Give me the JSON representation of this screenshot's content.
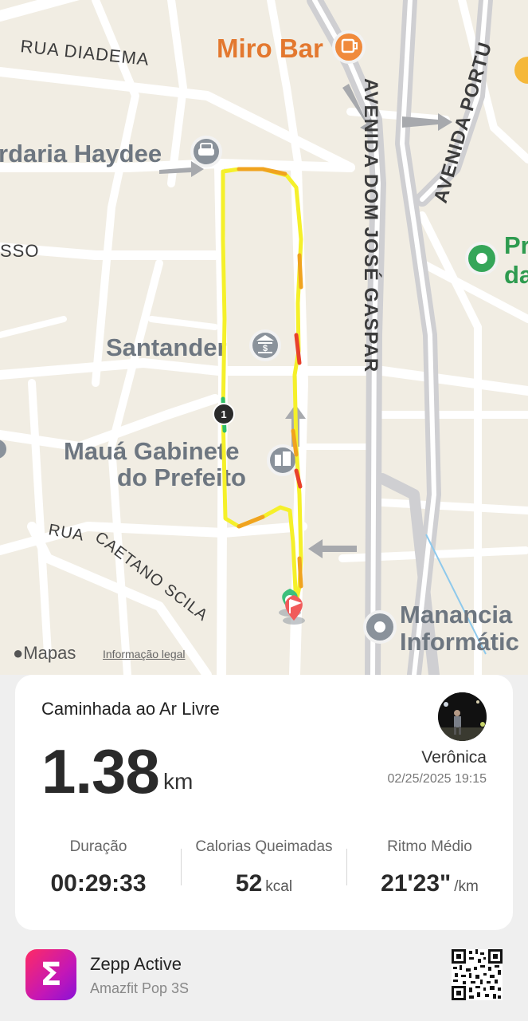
{
  "map": {
    "pois": [
      {
        "id": "miro-bar",
        "label": "Miro Bar",
        "icon": "cocktail-icon",
        "color": "#e3782f"
      },
      {
        "id": "haydee",
        "label": "rdaria Haydee",
        "icon": "car-icon",
        "color": "#7d8792"
      },
      {
        "id": "santander",
        "label": "Santander",
        "icon": "bank-icon",
        "color": "#7d8792"
      },
      {
        "id": "maua-1",
        "label": "Mauá Gabinete",
        "icon": "building-icon",
        "color": "#7d8792"
      },
      {
        "id": "maua-2",
        "label": "do Prefeito",
        "color": "#7d8792"
      },
      {
        "id": "pr-1",
        "label": "Pr",
        "icon": "park-icon",
        "color": "#2e9b4f"
      },
      {
        "id": "pr-2",
        "label": "da",
        "color": "#2e9b4f"
      },
      {
        "id": "manancia-1",
        "label": "Manancia",
        "icon": "pin-icon",
        "color": "#7d8792"
      },
      {
        "id": "manancia-2",
        "label": "Informátic",
        "color": "#7d8792"
      }
    ],
    "streets": [
      "RUA DIADEMA",
      "SSO",
      "RUA CAETANO SCILA",
      "AVENIDA DOM JOSÉ GASPAR",
      "AVENIDA PORTU"
    ],
    "km_marker": "1",
    "route_colors": {
      "fast": "#f5f02a",
      "slow": "#f0a31f",
      "slowest": "#e8412b",
      "start": "#2fbf6a"
    },
    "brand": "Mapas",
    "legal": "Informação legal"
  },
  "activity": {
    "type": "Caminhada ao Ar Livre",
    "distance": "1.38",
    "distance_unit": "km",
    "user_name": "Verônica",
    "timestamp": "02/25/2025 19:15"
  },
  "stats": [
    {
      "label": "Duração",
      "value": "00:29:33",
      "unit": ""
    },
    {
      "label": "Calorias Queimadas",
      "value": "52",
      "unit": "kcal"
    },
    {
      "label": "Ritmo Médio",
      "value": "21'23\"",
      "unit": "/km"
    }
  ],
  "footer": {
    "app_name": "Zepp Active",
    "device_name": "Amazfit Pop 3S",
    "logo_glyph": "Σ",
    "qr_icon": "qr-code-icon"
  }
}
